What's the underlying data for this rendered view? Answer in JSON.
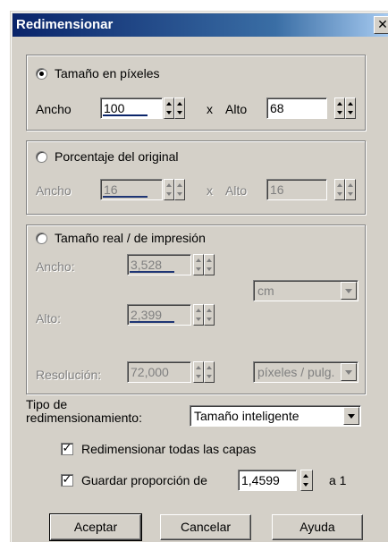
{
  "window": {
    "title": "Redimensionar",
    "close_glyph": "✕"
  },
  "pixel_size": {
    "radio_label": "Tamaño en píxeles",
    "selected": true,
    "width_label": "Ancho",
    "width_value": "100",
    "x_label": "x",
    "height_label": "Alto",
    "height_value": "68"
  },
  "percent_size": {
    "radio_label": "Porcentaje del original",
    "selected": false,
    "width_label": "Ancho",
    "width_value": "16",
    "x_label": "x",
    "height_label": "Alto",
    "height_value": "16"
  },
  "print_size": {
    "radio_label": "Tamaño real / de impresión",
    "selected": false,
    "width_label": "Ancho:",
    "width_value": "3,528",
    "height_label": "Alto:",
    "height_value": "2,399",
    "unit_value": "cm",
    "resolution_label": "Resolución:",
    "resolution_value": "72,000",
    "resolution_unit": "píxeles / pulg."
  },
  "resample": {
    "label_line1": "Tipo de",
    "label_line2": "redimensionamiento:",
    "value": "Tamaño inteligente"
  },
  "options": {
    "resize_all_layers_label": "Redimensionar todas las capas",
    "resize_all_layers_checked": true,
    "keep_ratio_label": "Guardar proporción de",
    "keep_ratio_checked": true,
    "ratio_value": "1,4599",
    "ratio_suffix": "a 1"
  },
  "buttons": {
    "ok": "Aceptar",
    "cancel": "Cancelar",
    "help": "Ayuda"
  },
  "colors": {
    "title_start": "#0a246a",
    "title_end": "#a6caf0",
    "face": "#d4d0c8"
  }
}
